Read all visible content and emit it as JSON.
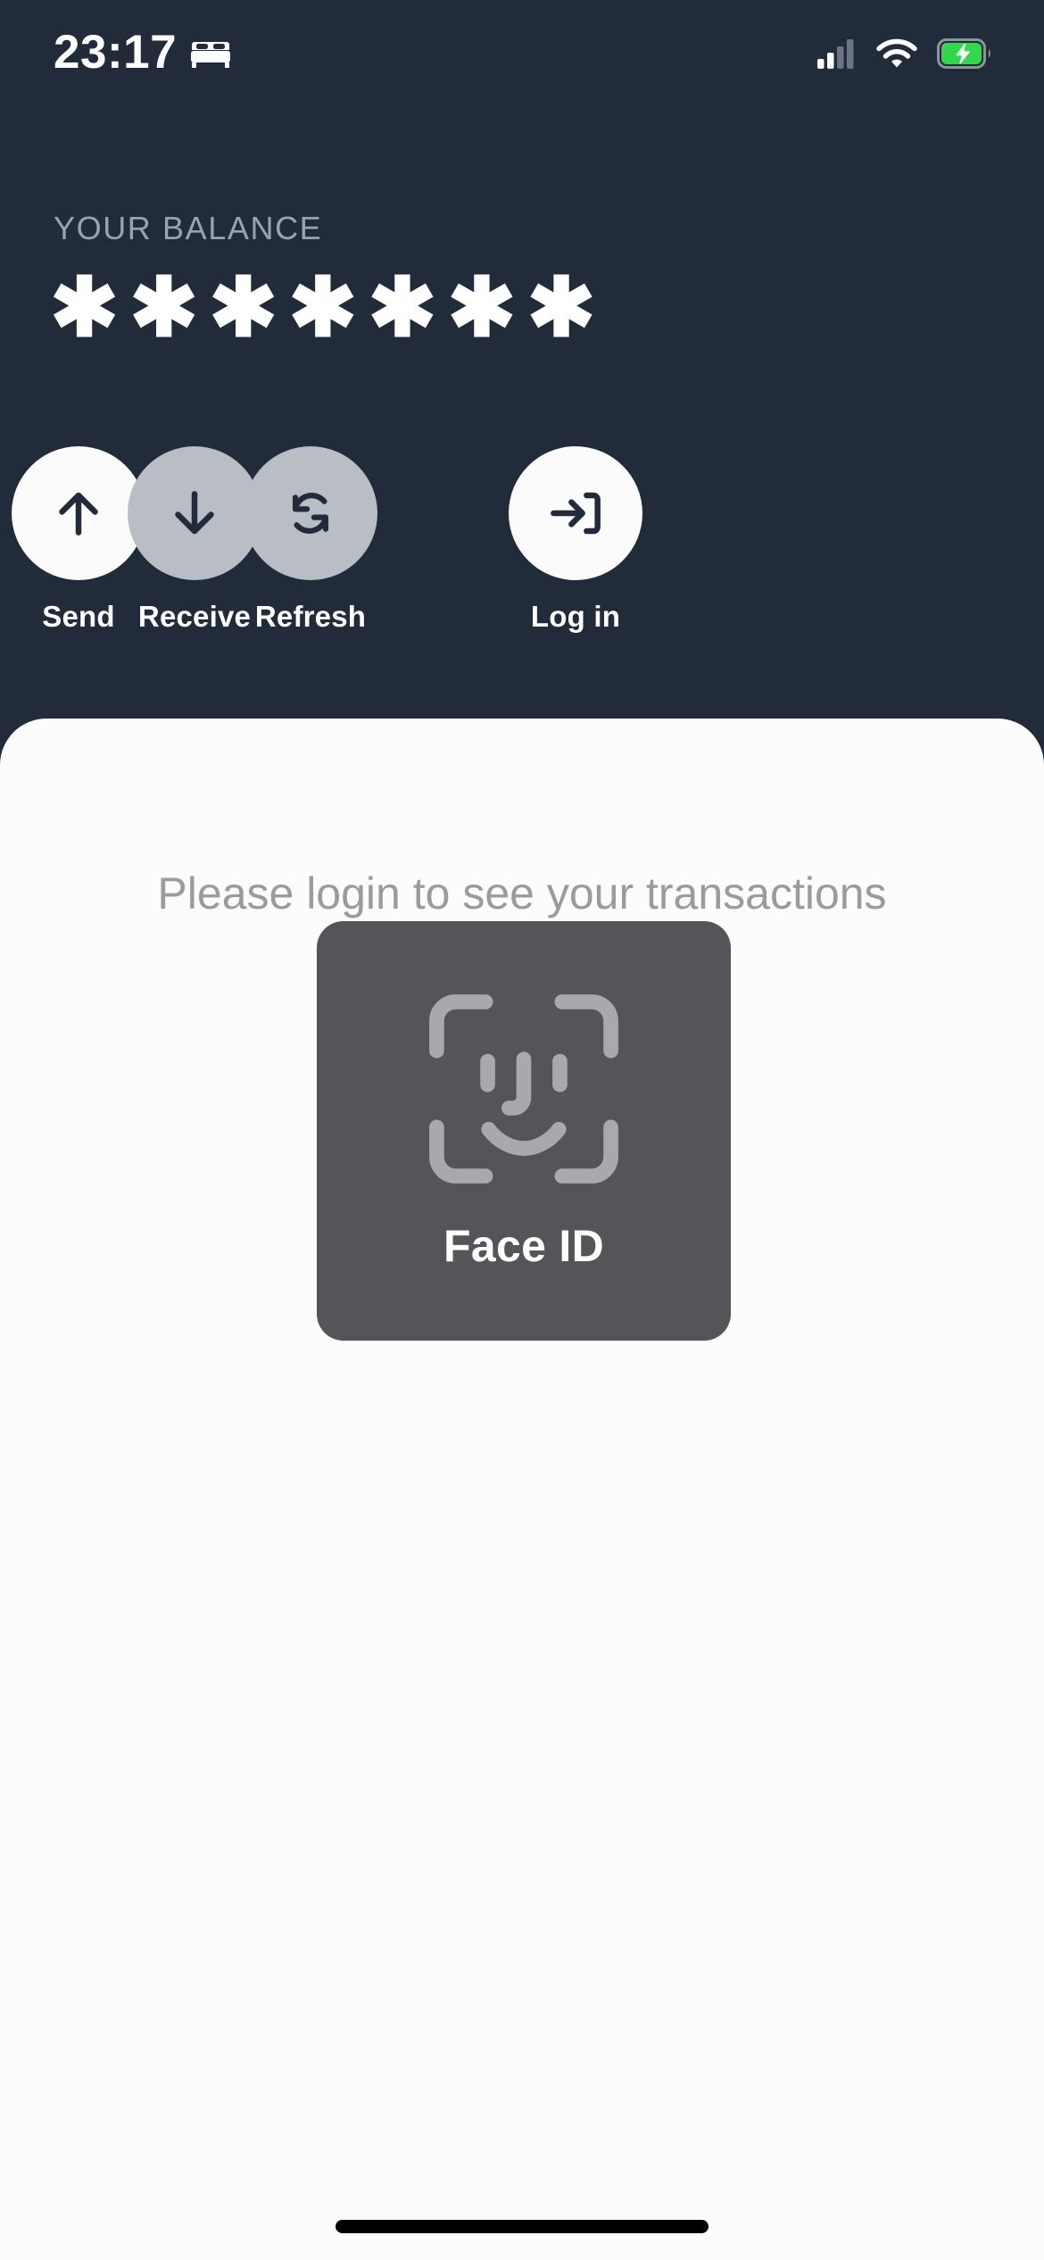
{
  "status_bar": {
    "time": "23:17",
    "focus_icon": "bed-icon",
    "signal_icon": "cellular-signal-icon",
    "signal_bars_filled": 2,
    "signal_bars_total": 4,
    "wifi_icon": "wifi-icon",
    "battery_icon": "battery-charging-icon",
    "battery_color": "#32d74b",
    "charging": true
  },
  "header": {
    "balance_label": "YOUR BALANCE",
    "balance_value": "✱✱✱✱✱✱✱",
    "background_color": "#222b3a"
  },
  "actions": [
    {
      "id": "send",
      "label": "Send",
      "icon": "arrow-up-icon",
      "state": "enabled",
      "circle_color": "#fbfbfb"
    },
    {
      "id": "receive",
      "label": "Receive",
      "icon": "arrow-down-icon",
      "state": "disabled",
      "circle_color": "#b9bec4"
    },
    {
      "id": "refresh",
      "label": "Refresh",
      "icon": "refresh-icon",
      "state": "disabled",
      "circle_color": "#b9bec4"
    },
    {
      "id": "login",
      "label": "Log in",
      "icon": "login-arrow-icon",
      "state": "enabled",
      "circle_color": "#fbfbfb"
    }
  ],
  "sheet": {
    "message": "Please login to see your transactions and balance",
    "background_color": "#fcfcfc",
    "text_color": "#9b9b9b"
  },
  "face_id_modal": {
    "label": "Face ID",
    "icon": "face-id-icon",
    "background_color": "#545558",
    "text_color": "#ffffff"
  },
  "home_indicator": {
    "name": "home-indicator",
    "color": "#000000"
  }
}
